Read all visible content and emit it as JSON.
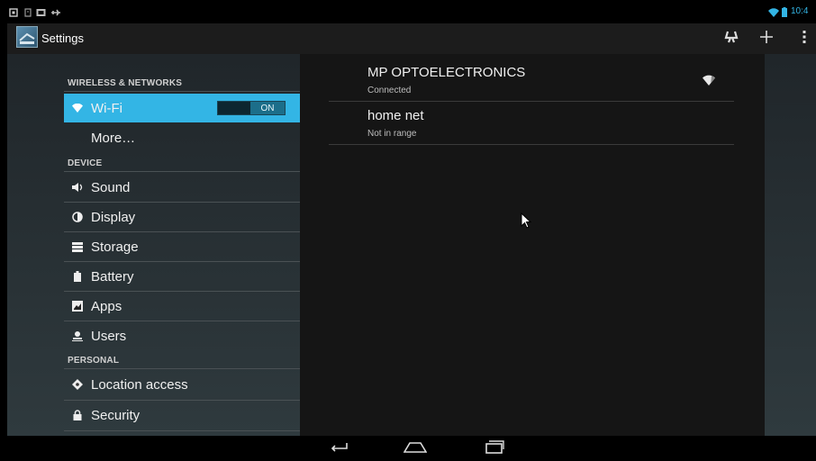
{
  "status_bar": {
    "time": "10:4",
    "icons": [
      "screenshot-icon",
      "sd-card-icon",
      "image-icon",
      "usb-icon",
      "wifi-icon",
      "battery-icon"
    ]
  },
  "action_bar": {
    "title": "Settings",
    "actions": [
      "sync-icon",
      "add-icon",
      "overflow-icon"
    ]
  },
  "sidebar": {
    "categories": {
      "wireless": "WIRELESS & NETWORKS",
      "device": "DEVICE",
      "personal": "PERSONAL"
    },
    "items": [
      {
        "label": "Wi-Fi",
        "icon": "wifi-icon",
        "selected": true
      },
      {
        "label": "More…",
        "icon": ""
      },
      {
        "label": "Sound",
        "icon": "speaker-icon"
      },
      {
        "label": "Display",
        "icon": "brightness-icon"
      },
      {
        "label": "Storage",
        "icon": "storage-icon"
      },
      {
        "label": "Battery",
        "icon": "battery-icon"
      },
      {
        "label": "Apps",
        "icon": "apps-icon"
      },
      {
        "label": "Users",
        "icon": "user-icon"
      },
      {
        "label": "Location access",
        "icon": "location-icon"
      },
      {
        "label": "Security",
        "icon": "lock-icon"
      }
    ],
    "wifi_toggle": "ON"
  },
  "networks": [
    {
      "name": "MP OPTOELECTRONICS",
      "status": "Connected"
    },
    {
      "name": "home net",
      "status": "Not in range"
    }
  ],
  "colors": {
    "accent": "#33b5e5",
    "action_bar": "#1c1c1c",
    "right_pane": "#151515"
  }
}
